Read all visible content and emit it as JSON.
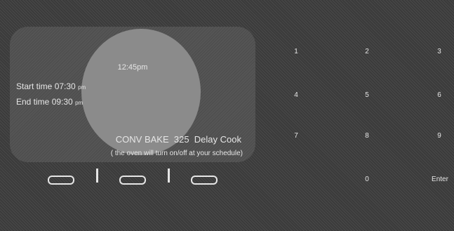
{
  "display": {
    "clock": "12:45pm",
    "start_label": "Start time",
    "start_time": "07:30",
    "start_ampm": "pm",
    "end_label": "End time",
    "end_time": "09:30",
    "end_ampm": "pm",
    "mode": "CONV BAKE  325  Delay Cook",
    "schedule_note": "( the oven will turn on/off at your schedule)"
  },
  "keypad": {
    "k1": "1",
    "k2": "2",
    "k3": "3",
    "k4": "4",
    "k5": "5",
    "k6": "6",
    "k7": "7",
    "k8": "8",
    "k9": "9",
    "k0": "0",
    "enter": "Enter"
  }
}
